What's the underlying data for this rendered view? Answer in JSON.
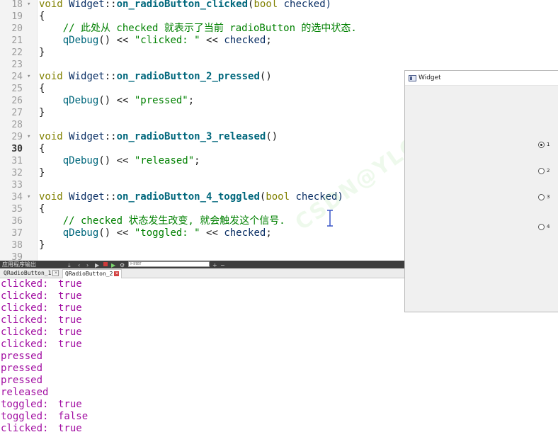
{
  "editor": {
    "lines": [
      {
        "num": "18",
        "fold": "▾",
        "segs": [
          {
            "t": "void ",
            "c": "kw"
          },
          {
            "t": "Widget",
            "c": "ident"
          },
          {
            "t": "::",
            "c": "op"
          },
          {
            "t": "on_radioButton_clicked",
            "c": "fn"
          },
          {
            "t": "(",
            "c": "op"
          },
          {
            "t": "bool",
            "c": "kw"
          },
          {
            "t": " checked)",
            "c": "ident"
          }
        ]
      },
      {
        "num": "19",
        "fold": "",
        "segs": [
          {
            "t": "{",
            "c": "op"
          }
        ]
      },
      {
        "num": "20",
        "fold": "",
        "segs": [
          {
            "t": "    // 此处从 checked 就表示了当前 radioButton 的选中状态.",
            "c": "cm"
          }
        ]
      },
      {
        "num": "21",
        "fold": "",
        "segs": [
          {
            "t": "    ",
            "c": "op"
          },
          {
            "t": "qDebug",
            "c": "call"
          },
          {
            "t": "() << ",
            "c": "op"
          },
          {
            "t": "\"clicked: \"",
            "c": "str"
          },
          {
            "t": " << ",
            "c": "op"
          },
          {
            "t": "checked",
            "c": "ident"
          },
          {
            "t": ";",
            "c": "op"
          }
        ]
      },
      {
        "num": "22",
        "fold": "",
        "segs": [
          {
            "t": "}",
            "c": "op"
          }
        ]
      },
      {
        "num": "23",
        "fold": "",
        "segs": []
      },
      {
        "num": "24",
        "fold": "▾",
        "segs": [
          {
            "t": "void ",
            "c": "kw"
          },
          {
            "t": "Widget",
            "c": "ident"
          },
          {
            "t": "::",
            "c": "op"
          },
          {
            "t": "on_radioButton_2_pressed",
            "c": "fn"
          },
          {
            "t": "()",
            "c": "op"
          }
        ]
      },
      {
        "num": "25",
        "fold": "",
        "segs": [
          {
            "t": "{",
            "c": "op"
          }
        ]
      },
      {
        "num": "26",
        "fold": "",
        "segs": [
          {
            "t": "    ",
            "c": "op"
          },
          {
            "t": "qDebug",
            "c": "call"
          },
          {
            "t": "() << ",
            "c": "op"
          },
          {
            "t": "\"pressed\"",
            "c": "str"
          },
          {
            "t": ";",
            "c": "op"
          }
        ]
      },
      {
        "num": "27",
        "fold": "",
        "segs": [
          {
            "t": "}",
            "c": "op"
          }
        ]
      },
      {
        "num": "28",
        "fold": "",
        "segs": []
      },
      {
        "num": "29",
        "fold": "▾",
        "segs": [
          {
            "t": "void ",
            "c": "kw"
          },
          {
            "t": "Widget",
            "c": "ident"
          },
          {
            "t": "::",
            "c": "op"
          },
          {
            "t": "on_radioButton_3_released",
            "c": "fn"
          },
          {
            "t": "()",
            "c": "op"
          }
        ]
      },
      {
        "num": "30",
        "fold": "",
        "cur": true,
        "segs": [
          {
            "t": "{",
            "c": "op"
          }
        ]
      },
      {
        "num": "31",
        "fold": "",
        "segs": [
          {
            "t": "    ",
            "c": "op"
          },
          {
            "t": "qDebug",
            "c": "call"
          },
          {
            "t": "() << ",
            "c": "op"
          },
          {
            "t": "\"released\"",
            "c": "str"
          },
          {
            "t": ";",
            "c": "op"
          }
        ]
      },
      {
        "num": "32",
        "fold": "",
        "segs": [
          {
            "t": "}",
            "c": "op"
          }
        ]
      },
      {
        "num": "33",
        "fold": "",
        "segs": []
      },
      {
        "num": "34",
        "fold": "▾",
        "segs": [
          {
            "t": "void ",
            "c": "kw"
          },
          {
            "t": "Widget",
            "c": "ident"
          },
          {
            "t": "::",
            "c": "op"
          },
          {
            "t": "on_radioButton_4_toggled",
            "c": "fn"
          },
          {
            "t": "(",
            "c": "op"
          },
          {
            "t": "bool",
            "c": "kw"
          },
          {
            "t": " checked)",
            "c": "ident"
          }
        ]
      },
      {
        "num": "35",
        "fold": "",
        "segs": [
          {
            "t": "{",
            "c": "op"
          }
        ]
      },
      {
        "num": "36",
        "fold": "",
        "segs": [
          {
            "t": "    // checked 状态发生改变, 就会触发这个信号.",
            "c": "cm"
          }
        ]
      },
      {
        "num": "37",
        "fold": "",
        "segs": [
          {
            "t": "    ",
            "c": "op"
          },
          {
            "t": "qDebug",
            "c": "call"
          },
          {
            "t": "() << ",
            "c": "op"
          },
          {
            "t": "\"toggled: \"",
            "c": "str"
          },
          {
            "t": " << ",
            "c": "op"
          },
          {
            "t": "checked",
            "c": "ident"
          },
          {
            "t": ";",
            "c": "op"
          }
        ]
      },
      {
        "num": "38",
        "fold": "",
        "segs": [
          {
            "t": "}",
            "c": "op"
          }
        ]
      },
      {
        "num": "39",
        "fold": "",
        "segs": []
      }
    ],
    "watermark": "CSDN@YLGS"
  },
  "output_pane": {
    "title": "应用程序输出",
    "filter_placeholder": "Filter",
    "plus": "+",
    "minus": "−",
    "tabs": [
      {
        "label": "QRadioButton_1",
        "active": false
      },
      {
        "label": "QRadioButton_2",
        "active": true
      }
    ],
    "lines": [
      {
        "key": "clicked:",
        "val": "true"
      },
      {
        "key": "clicked:",
        "val": "true"
      },
      {
        "key": "clicked:",
        "val": "true"
      },
      {
        "key": "clicked:",
        "val": "true"
      },
      {
        "key": "clicked:",
        "val": "true"
      },
      {
        "key": "clicked:",
        "val": "true"
      },
      {
        "key": "pressed",
        "val": ""
      },
      {
        "key": "pressed",
        "val": ""
      },
      {
        "key": "pressed",
        "val": ""
      },
      {
        "key": "released",
        "val": ""
      },
      {
        "key": "toggled:",
        "val": "true"
      },
      {
        "key": "toggled:",
        "val": "false"
      },
      {
        "key": "clicked:",
        "val": "true"
      }
    ]
  },
  "widget_window": {
    "title": "Widget",
    "radios": [
      {
        "label": "1",
        "checked": true
      },
      {
        "label": "2",
        "checked": false
      },
      {
        "label": "3",
        "checked": false
      },
      {
        "label": "4",
        "checked": false
      }
    ]
  }
}
